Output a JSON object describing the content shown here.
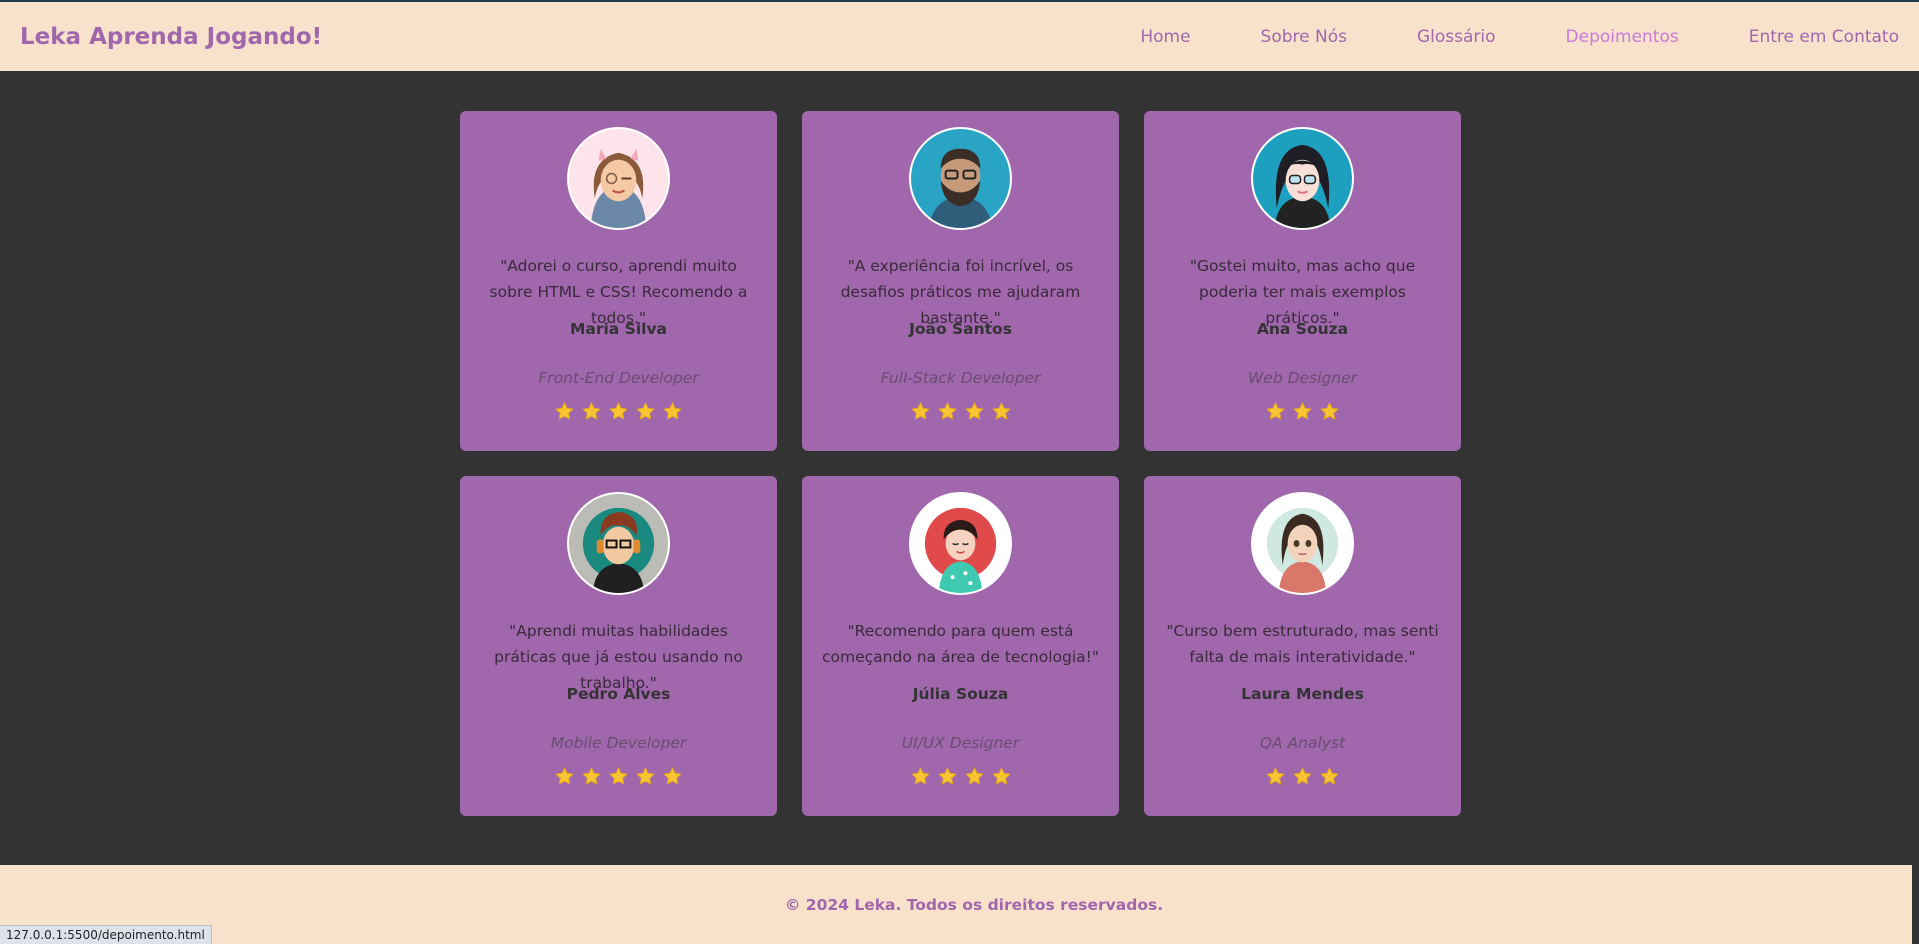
{
  "header": {
    "brand": "Leka Aprenda Jogando!",
    "nav": [
      {
        "label": "Home"
      },
      {
        "label": "Sobre Nós"
      },
      {
        "label": "Glossário"
      },
      {
        "label": "Depoimentos",
        "active": true
      },
      {
        "label": "Entre em Contato"
      }
    ]
  },
  "testimonials": [
    {
      "quote": "\"Adorei o curso, aprendi muito sobre HTML e CSS! Recomendo a todos.\"",
      "name": "Maria Silva",
      "role": "Front-End Developer",
      "rating": 5,
      "avatar": "woman-cat-ears-winking-avatar"
    },
    {
      "quote": "\"A experiência foi incrível, os desafios práticos me ajudaram bastante.\"",
      "name": "João Santos",
      "role": "Full-Stack Developer",
      "rating": 4,
      "avatar": "bearded-man-glasses-avatar"
    },
    {
      "quote": "\"Gostei muito, mas acho que poderia ter mais exemplos práticos.\"",
      "name": "Ana Souza",
      "role": "Web Designer",
      "rating": 3,
      "avatar": "woman-dark-hair-glasses-avatar"
    },
    {
      "quote": "\"Aprendi muitas habilidades práticas que já estou usando no trabalho.\"",
      "name": "Pedro Alves",
      "role": "Mobile Developer",
      "rating": 5,
      "avatar": "boy-headphones-glasses-avatar"
    },
    {
      "quote": "\"Recomendo para quem está começando na área de tecnologia!\"",
      "name": "Júlia Souza",
      "role": "UI/UX Designer",
      "rating": 4,
      "avatar": "girl-smiling-avatar"
    },
    {
      "quote": "\"Curso bem estruturado, mas senti falta de mais interatividade.\"",
      "name": "Laura Mendes",
      "role": "QA Analyst",
      "rating": 3,
      "avatar": "woman-brown-hair-avatar"
    }
  ],
  "footer": {
    "text": "© 2024 Leka. Todos os direitos reservados."
  },
  "status_url": "127.0.0.1:5500/depoimento.html",
  "colors": {
    "accent": "#a067ad",
    "header_bg": "#f9e2cc",
    "page_bg": "#333333",
    "star": "#f7c531"
  }
}
